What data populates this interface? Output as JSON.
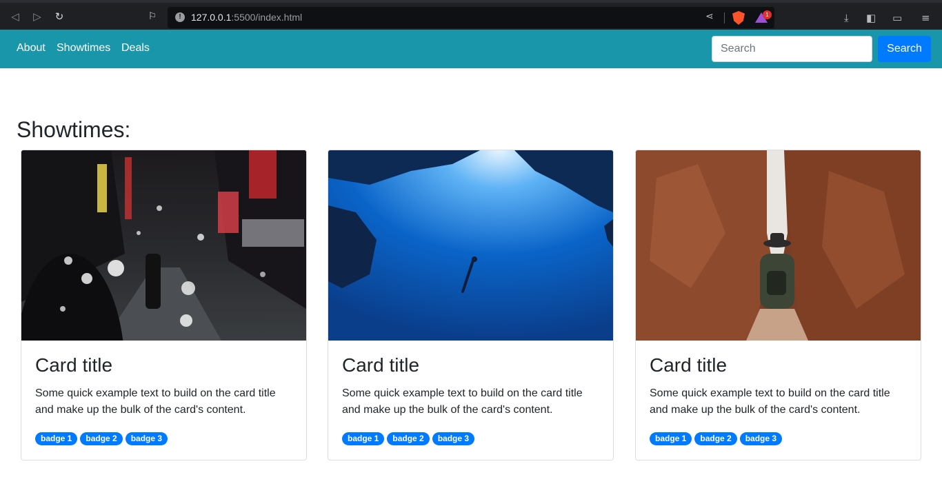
{
  "browser": {
    "url_host": "127.0.0.1",
    "url_rest": ":5500/index.html",
    "rewards_count": "1"
  },
  "navbar": {
    "links": [
      "About",
      "Showtimes",
      "Deals"
    ],
    "search_placeholder": "Search",
    "search_button": "Search"
  },
  "main": {
    "heading": "Showtimes:",
    "cards": [
      {
        "image": "rainy-city-street-at-night",
        "title": "Card title",
        "text": "Some quick example text to build on the card title and make up the bulk of the card's content.",
        "badges": [
          "badge 1",
          "badge 2",
          "badge 3"
        ]
      },
      {
        "image": "underwater-diver",
        "title": "Card title",
        "text": "Some quick example text to build on the card title and make up the bulk of the card's content.",
        "badges": [
          "badge 1",
          "badge 2",
          "badge 3"
        ]
      },
      {
        "image": "hiker-in-canyon",
        "title": "Card title",
        "text": "Some quick example text to build on the card title and make up the bulk of the card's content.",
        "badges": [
          "badge 1",
          "badge 2",
          "badge 3"
        ]
      }
    ]
  },
  "colors": {
    "navbar": "#1a96aa",
    "primary": "#007bff",
    "chrome": "#1f2024"
  }
}
